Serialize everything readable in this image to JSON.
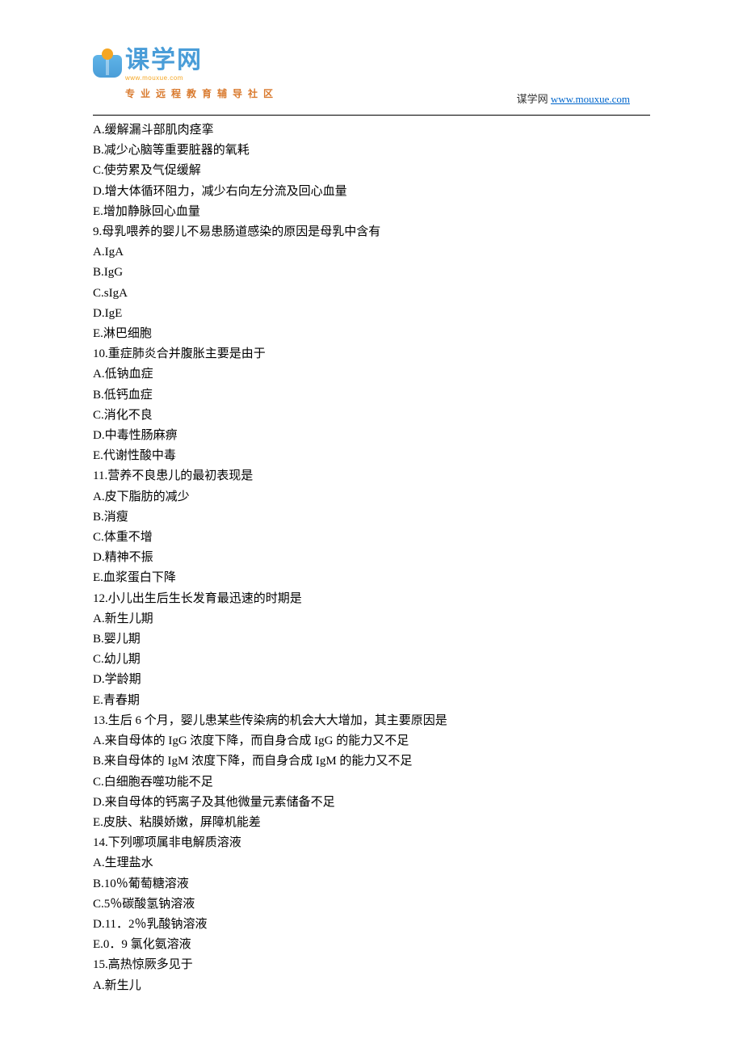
{
  "header": {
    "logo_text": "课学网",
    "logo_url": "www.mouxue.com",
    "tagline": "专业远程教育辅导社区",
    "right_label": "谋学网",
    "right_link": "www.mouxue.com"
  },
  "lines": [
    "A.缓解漏斗部肌肉痉挛",
    "B.减少心脑等重要脏器的氧耗",
    "C.使劳累及气促缓解",
    "D.增大体循环阻力，减少右向左分流及回心血量",
    "E.增加静脉回心血量",
    "9.母乳喂养的婴儿不易患肠道感染的原因是母乳中含有",
    "A.IgA",
    "B.IgG",
    "C.sIgA",
    "D.IgE",
    "E.淋巴细胞",
    "10.重症肺炎合并腹胀主要是由于",
    "A.低钠血症",
    "B.低钙血症",
    "C.消化不良",
    "D.中毒性肠麻痹",
    "E.代谢性酸中毒",
    "11.营养不良患儿的最初表现是",
    "A.皮下脂肪的减少",
    "B.消瘦",
    "C.体重不增",
    "D.精神不振",
    "E.血浆蛋白下降",
    "12.小儿出生后生长发育最迅速的时期是",
    "A.新生儿期",
    "B.婴儿期",
    "C.幼儿期",
    "D.学龄期",
    "E.青春期",
    "13.生后 6 个月，婴儿患某些传染病的机会大大增加，其主要原因是",
    "A.来自母体的 IgG 浓度下降，而自身合成 IgG 的能力又不足",
    "B.来自母体的 IgM 浓度下降，而自身合成 IgM 的能力又不足",
    "C.白细胞吞噬功能不足",
    "D.来自母体的钙离子及其他微量元素储备不足",
    "E.皮肤、粘膜娇嫩，屏障机能差",
    "14.下列哪项属非电解质溶液",
    "A.生理盐水",
    "B.10％葡萄糖溶液",
    "C.5％碳酸氢钠溶液",
    "D.11．2％乳酸钠溶液",
    "E.0．9 氯化氨溶液",
    "15.高热惊厥多见于",
    "A.新生儿"
  ]
}
